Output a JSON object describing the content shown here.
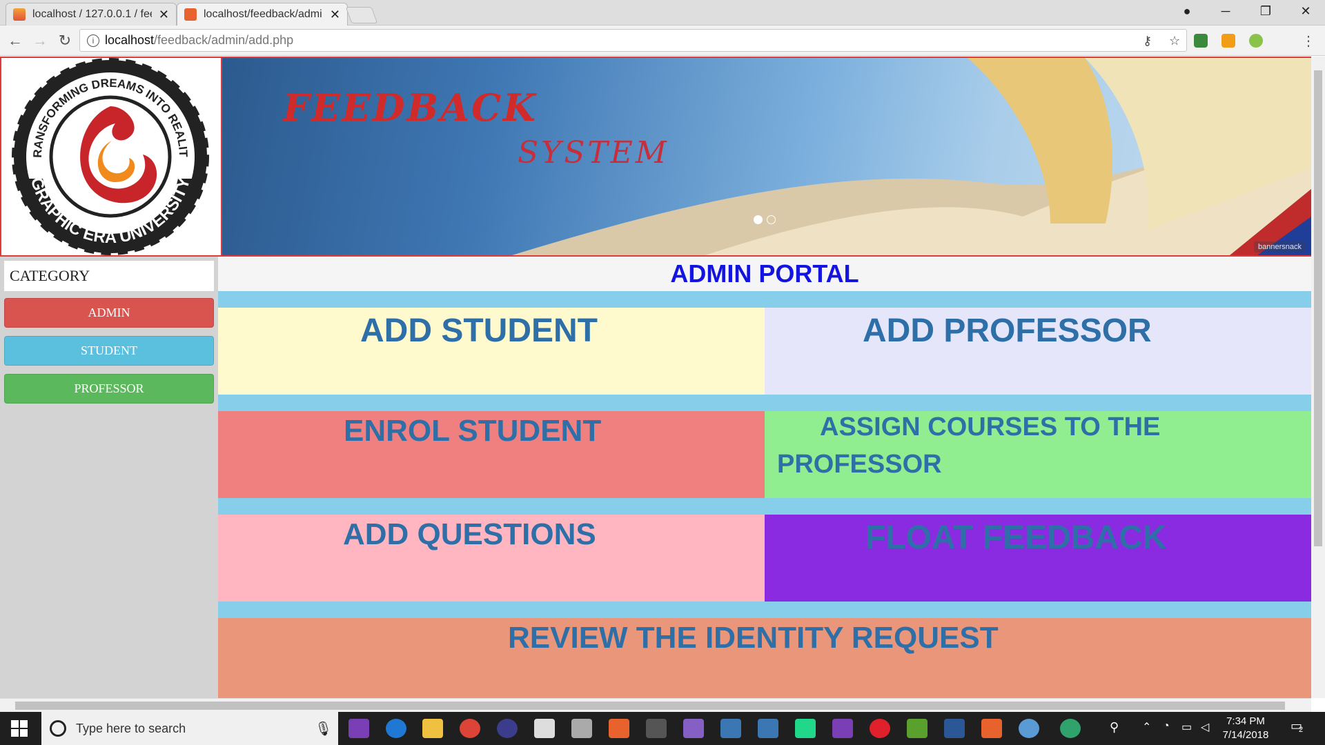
{
  "browser": {
    "tabs": [
      {
        "title": "localhost / 127.0.0.1 / fee",
        "active": false
      },
      {
        "title": "localhost/feedback/admi",
        "active": true
      }
    ],
    "url_host": "localhost",
    "url_path": "/feedback/admin/add.php"
  },
  "banner": {
    "title": "FEEDBACK",
    "subtitle": "SYSTEM",
    "credit": "bannersnack"
  },
  "logo": {
    "top_text": "TRANSFORMING DREAMS INTO REALITY",
    "bottom_text": "GRAPHIC ERA UNIVERSITY"
  },
  "sidebar": {
    "category_label": "CATEGORY",
    "buttons": [
      {
        "label": "ADMIN",
        "color": "#d9534f"
      },
      {
        "label": "STUDENT",
        "color": "#5bc0de"
      },
      {
        "label": "PROFESSOR",
        "color": "#5cb85c"
      }
    ]
  },
  "main": {
    "portal_title": "ADMIN PORTAL",
    "tiles": [
      {
        "label": "ADD STUDENT",
        "color": "#fffacd"
      },
      {
        "label": "ADD PROFESSOR",
        "color": "#e6e6fa"
      },
      {
        "label": "ENROL STUDENT",
        "color": "#f08080"
      },
      {
        "label_line1": "ASSIGN COURSES TO THE",
        "label_line2": "PROFESSOR",
        "color": "#90ee90"
      },
      {
        "label": "ADD QUESTIONS",
        "color": "#ffb6c1"
      },
      {
        "label": "FLOAT FEEDBACK",
        "color": "#8a2be2"
      },
      {
        "label": "REVIEW THE IDENTITY REQUEST",
        "color": "#e9967a"
      }
    ]
  },
  "taskbar": {
    "search_placeholder": "Type here to search",
    "time": "7:34 PM",
    "date": "7/14/2018",
    "notifications": "2"
  }
}
